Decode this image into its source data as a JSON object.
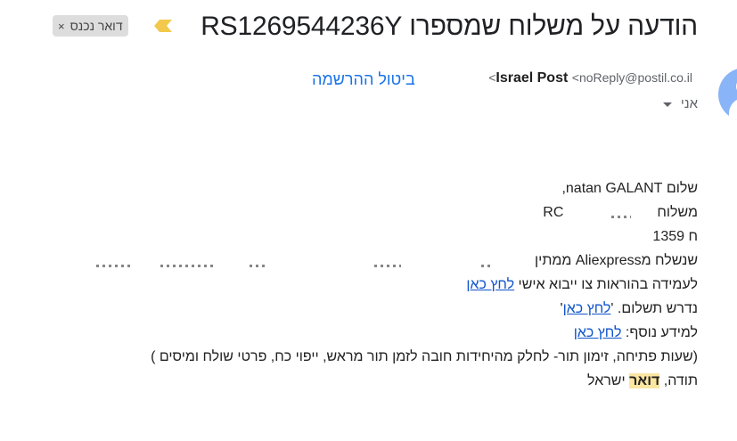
{
  "email": {
    "subject": "הודעה על משלוח שמספרו RS1269544236Y",
    "label_chip": "דואר נכנס",
    "label_close": "×",
    "sender_name": "Israel Post",
    "sender_email": "<noReply@postil.co.il>",
    "unsubscribe": "ביטול ההרשמה",
    "recipient": "אני"
  },
  "body": {
    "greeting": "שלום natan GALANT,",
    "shipment_prefix": "משלוח",
    "shipment_code_fragment": "RC",
    "line3": "ח 1359",
    "line4": "שנשלח מAliexpress ממתין",
    "line5_text": "לעמידה בהוראות צו ייבוא אישי ",
    "line5_link": "לחץ כאן",
    "line6_text": "נדרש תשלום. '",
    "line6_link": "לחץ כאן",
    "line6_suffix": "'",
    "line7_text": "למידע נוסף: ",
    "line7_link": "לחץ כאן",
    "line8": "(שעות פתיחה, זימון תור- לחלק מהיחידות חובה לזמן תור מראש, ייפוי כח, פרטי שולח ומיסים )",
    "sign_prefix": "תודה, ",
    "sign_highlight": "דואר",
    "sign_suffix": " ישראל"
  },
  "colors": {
    "link": "#1155cc",
    "unsubscribe": "#1a73e8",
    "highlight": "#fbe6a2",
    "important": "#f2c94c"
  }
}
